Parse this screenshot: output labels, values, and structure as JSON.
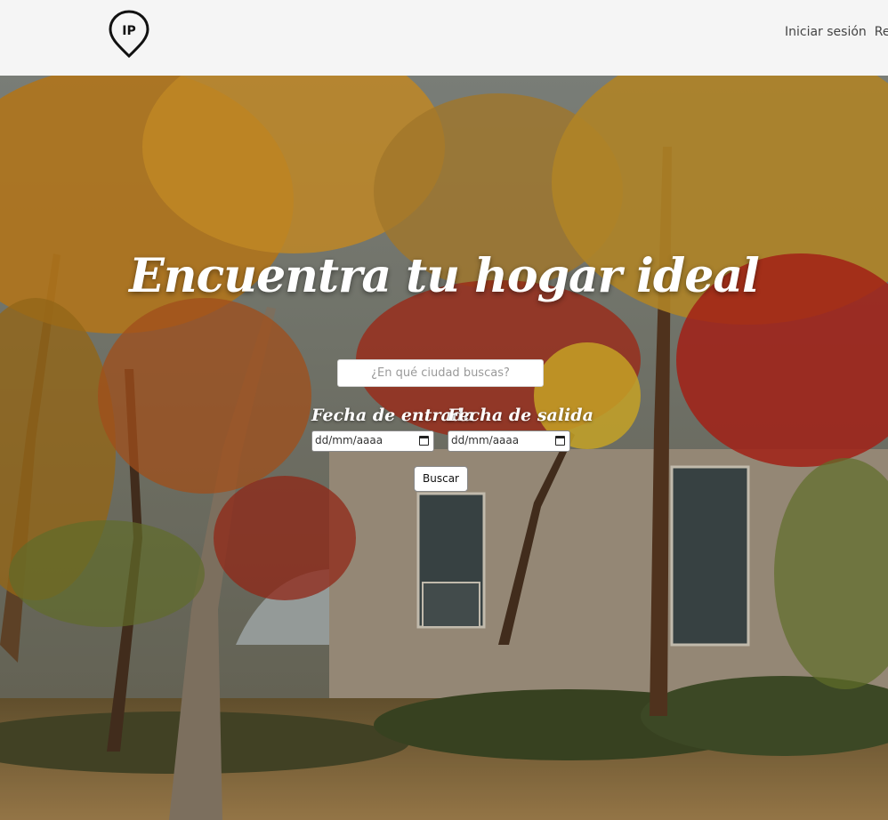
{
  "header": {
    "logo_text": "IP",
    "nav": [
      "Iniciar sesión",
      "Registrarse"
    ]
  },
  "hero": {
    "title": "Encuentra tu hogar ideal",
    "city_placeholder": "¿En qué ciudad buscas?",
    "checkin_label": "Fecha de entrada",
    "checkout_label": "Fecha de salida",
    "checkin_value": "dd/mm/aaaa",
    "checkout_value": "dd/mm/aaaa",
    "search_button": "Buscar"
  }
}
